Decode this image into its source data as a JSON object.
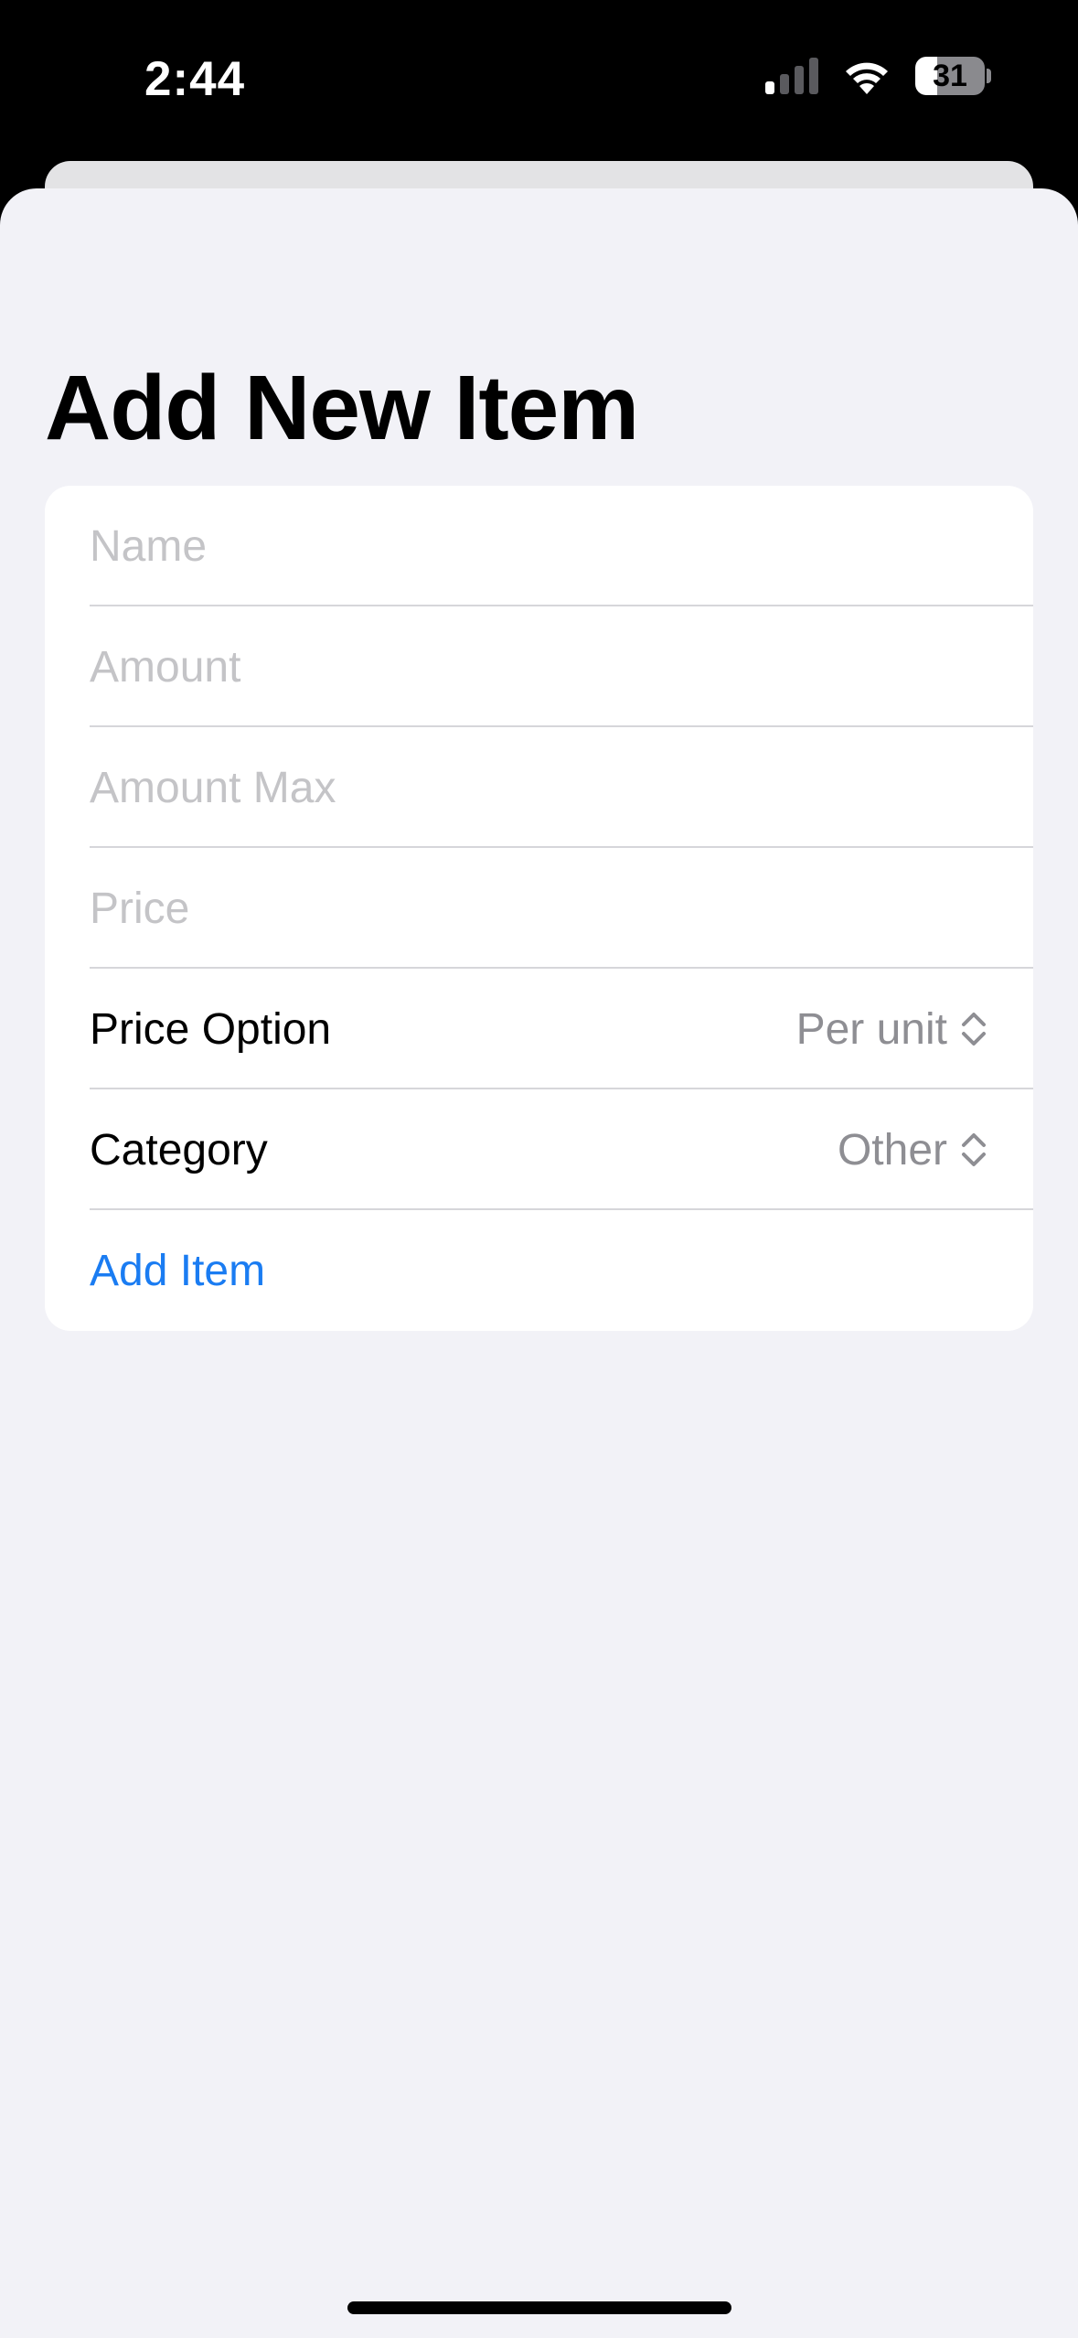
{
  "status_bar": {
    "time": "2:44",
    "battery_level": "31",
    "battery_fraction": 0.31,
    "signal_bars_active": 1,
    "signal_bars_total": 4
  },
  "sheet": {
    "title": "Add New Item"
  },
  "form": {
    "name_placeholder": "Name",
    "amount_placeholder": "Amount",
    "amount_max_placeholder": "Amount Max",
    "price_placeholder": "Price",
    "price_option_label": "Price Option",
    "price_option_value": "Per unit",
    "category_label": "Category",
    "category_value": "Other",
    "add_item_label": "Add Item"
  },
  "colors": {
    "accent": "#1a7cf2",
    "background": "#f2f2f7",
    "card": "#ffffff",
    "secondary_text": "#8e8e93",
    "placeholder": "#c4c4c7"
  },
  "icons": {
    "signal": "cellular-signal-icon",
    "wifi": "wifi-icon",
    "battery": "battery-icon",
    "picker": "chevron-updown-icon"
  }
}
